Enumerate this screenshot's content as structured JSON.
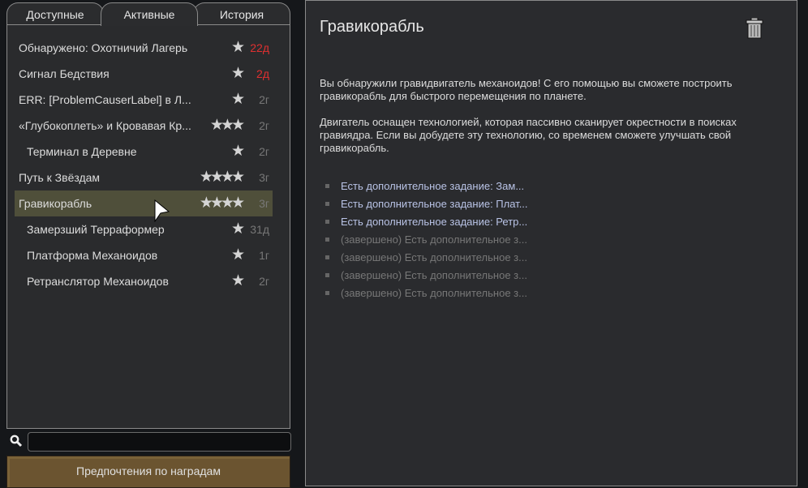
{
  "tabs": [
    {
      "label": "Доступные"
    },
    {
      "label": "Активные",
      "active": true
    },
    {
      "label": "История"
    }
  ],
  "quests": [
    {
      "label": "Обнаружено: Охотничий Лагерь",
      "stars": "★",
      "time": "22д",
      "urgent": true,
      "sub": false
    },
    {
      "label": "Сигнал Бедствия",
      "stars": "★",
      "time": "2д",
      "urgent": true,
      "sub": false
    },
    {
      "label": "ERR: [ProblemCauserLabel] в Л...",
      "stars": "★",
      "time": "2г",
      "urgent": false,
      "sub": false
    },
    {
      "label": "«Глубокоплеть» и Кровавая Кр...",
      "stars": "★★★",
      "time": "2г",
      "urgent": false,
      "sub": false
    },
    {
      "label": "Терминал в Деревне",
      "stars": "★",
      "time": "2г",
      "urgent": false,
      "sub": true
    },
    {
      "label": "Путь к Звёздам",
      "stars": "★★★★",
      "time": "3г",
      "urgent": false,
      "sub": false
    },
    {
      "label": "Гравикорабль",
      "stars": "★★★★",
      "time": "3г",
      "urgent": false,
      "sub": false,
      "selected": true
    },
    {
      "label": "Замерзший Терраформер",
      "stars": "★",
      "time": "31д",
      "urgent": false,
      "sub": true
    },
    {
      "label": "Платформа Механоидов",
      "stars": "★",
      "time": "1г",
      "urgent": false,
      "sub": true
    },
    {
      "label": "Ретранслятор Механоидов",
      "stars": "★",
      "time": "2г",
      "urgent": false,
      "sub": true
    }
  ],
  "search": {
    "value": ""
  },
  "reward_prefs_label": "Предпочтения по наградам",
  "detail": {
    "title": "Гравикорабль",
    "paragraphs": [
      "Вы обнаружили гравидвигатель механоидов! С его помощью вы сможете построить гравикорабль для быстрого перемещения по планете.",
      "Двигатель оснащен технологией, которая пассивно сканирует окрестности в поисках гравиядра. Если вы добудете эту технологию, со временем сможете улучшать свой гравикорабль."
    ],
    "objectives": [
      {
        "text": "Есть дополнительное задание: Зам...",
        "done": false
      },
      {
        "text": "Есть дополнительное задание: Плат...",
        "done": false
      },
      {
        "text": "Есть дополнительное задание: Ретр...",
        "done": false
      },
      {
        "text": "(завершено) Есть дополнительное з...",
        "done": true
      },
      {
        "text": "(завершено) Есть дополнительное з...",
        "done": true
      },
      {
        "text": "(завершено) Есть дополнительное з...",
        "done": true
      },
      {
        "text": "(завершено) Есть дополнительное з...",
        "done": true
      }
    ]
  },
  "colors": {
    "urgent": "#e03030",
    "selected_row": "#4f4f3a",
    "button": "#6b5430",
    "objective": "#b9c3e6"
  }
}
